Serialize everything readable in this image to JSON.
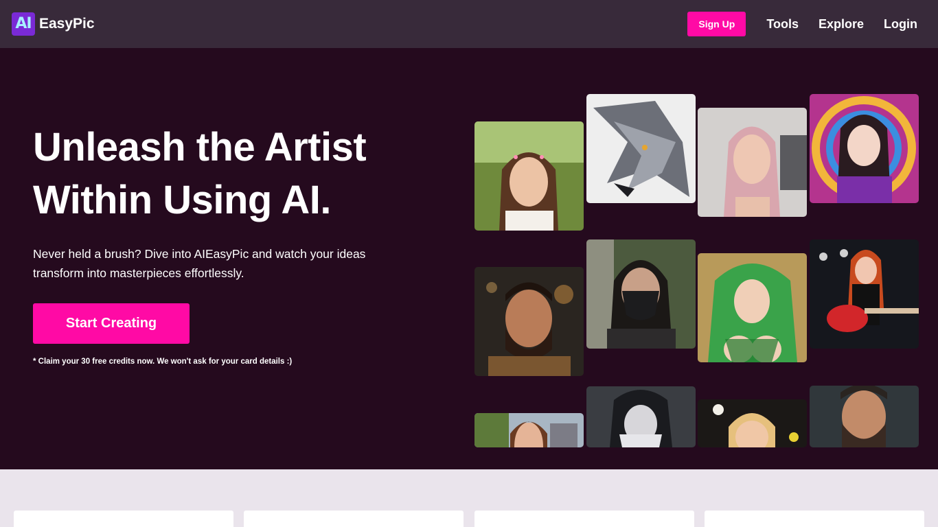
{
  "navbar": {
    "logo_badge": "AI",
    "brand": "EasyPic",
    "signup_label": "Sign Up",
    "links": [
      "Tools",
      "Explore",
      "Login"
    ]
  },
  "hero": {
    "title_line1": "Unleash the Artist",
    "title_line2": "Within Using AI.",
    "subtitle_line1": "Never held a brush? Dive into AIEasyPic and watch your ideas",
    "subtitle_line2": "transform into masterpieces effortlessly.",
    "cta_label": "Start Creating",
    "note": "* Claim your 30 free credits now. We won't ask for your card details :)"
  },
  "gallery": [
    "girl-flower-crown-portrait",
    "white-wolf-illustration",
    "pink-hair-woman-selfie",
    "psychedelic-anime-girl",
    "bearded-warrior-portrait",
    "masked-ninja-woman",
    "green-hair-elf",
    "redhead-guitarist",
    "girl-castle-portrait",
    "anime-girl-rain",
    "blonde-woman-bokeh",
    "bearded-man-portrait"
  ],
  "colors": {
    "accent": "#ff0aa5",
    "navbar_bg": "#382a3a",
    "hero_bg": "#250a1e",
    "page_bg": "#eae4ec"
  }
}
